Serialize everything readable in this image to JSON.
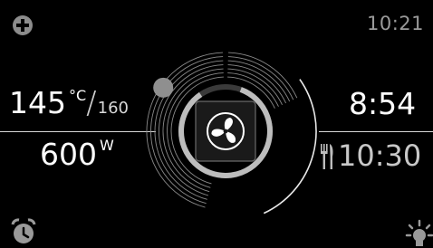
{
  "status": {
    "clock": "10:21"
  },
  "left": {
    "temperature_current": "145",
    "temperature_unit": "°C",
    "temperature_separator": "/",
    "temperature_target": "160",
    "power_value": "600",
    "power_unit": "W"
  },
  "right": {
    "timer_duration": "8:54",
    "end_time": "10:30"
  },
  "center": {
    "mode": "fan-icon",
    "progress_fraction": 0.85
  },
  "icons": {
    "top_left": "plus-icon",
    "bottom_left": "alarm-clock-icon",
    "bottom_right": "oven-light-icon",
    "end_time_icon": "fork-knife-icon"
  },
  "colors": {
    "background": "#000000",
    "text_primary": "#ffffff",
    "text_muted": "#9a9a9a",
    "ring": "#bdbdbd",
    "knob": "#8f8f8f"
  }
}
